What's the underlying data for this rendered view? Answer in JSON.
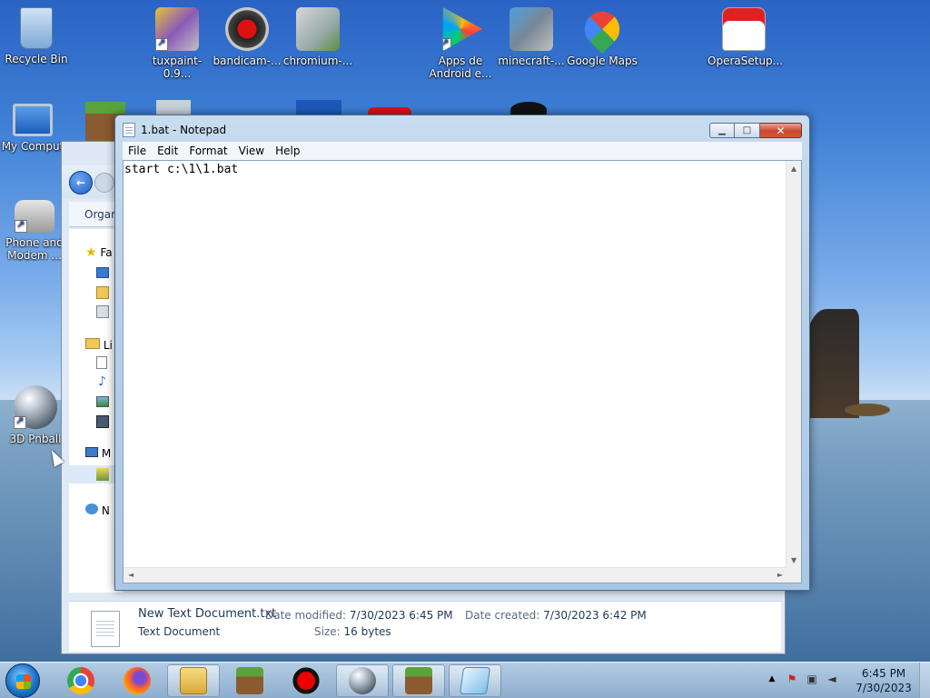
{
  "desktop": {
    "icons": [
      {
        "label": "Recycle Bin"
      },
      {
        "label": "tuxpaint-0.9..."
      },
      {
        "label": "bandicam-..."
      },
      {
        "label": "chromium-..."
      },
      {
        "label": "Apps de Android e..."
      },
      {
        "label": "minecraft-..."
      },
      {
        "label": "Google Maps"
      },
      {
        "label": "OperaSetup..."
      },
      {
        "label": "My Comput"
      },
      {
        "label": "Phone and Modem ..."
      },
      {
        "label": "3D Pnball"
      }
    ]
  },
  "explorer": {
    "organize": "Organ",
    "nav": {
      "favorites": "Fa",
      "libraries": "Li",
      "computer": "M",
      "network": "N"
    },
    "details": {
      "filename": "New Text Document.txt",
      "filetype": "Text Document",
      "date_modified_label": "Date modified:",
      "date_modified": "7/30/2023 6:45 PM",
      "date_created_label": "Date created:",
      "date_created": "7/30/2023 6:42 PM",
      "size_label": "Size:",
      "size": "16 bytes"
    }
  },
  "notepad": {
    "title": "1.bat - Notepad",
    "menu": [
      "File",
      "Edit",
      "Format",
      "View",
      "Help"
    ],
    "content": "start c:\\1\\1.bat",
    "buttons": {
      "minimize": "▁",
      "maximize": "□",
      "close": "✕"
    }
  },
  "taskbar": {
    "clock_time": "6:45 PM",
    "clock_date": "7/30/2023",
    "tray_up": "▲",
    "tray_flag": "⚑",
    "tray_network": "▣",
    "tray_volume": "◄"
  },
  "colors": {
    "notepad_frame": "#b7d0e8",
    "close_button": "#c9472f",
    "taskbar": "#a7c1dd"
  }
}
